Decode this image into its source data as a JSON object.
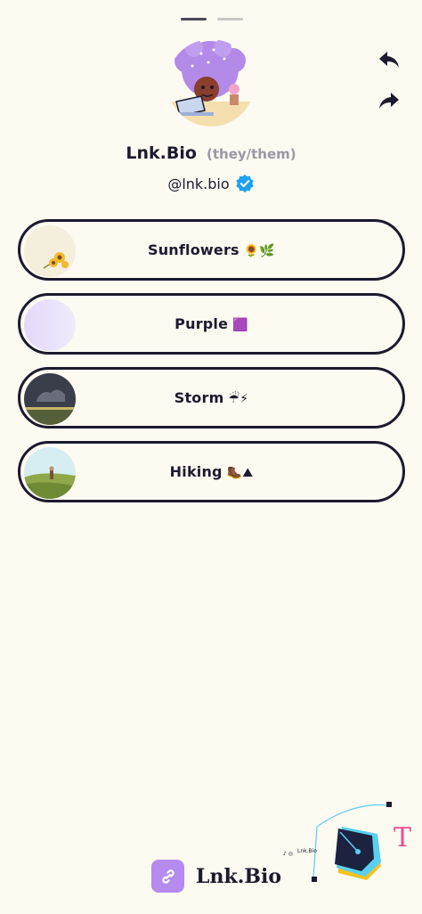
{
  "profile": {
    "name": "Lnk.Bio",
    "pronouns": "(they/them)",
    "handle": "@lnk.bio"
  },
  "links": [
    {
      "label": "Sunflowers",
      "emoji": "🌻🌿"
    },
    {
      "label": "Purple",
      "emoji": "🟪"
    },
    {
      "label": "Storm",
      "emoji": "☔⚡"
    },
    {
      "label": "Hiking",
      "emoji": "🥾⛰"
    }
  ],
  "footer": {
    "logo_text": "Lnk.Bio",
    "promo_handle": "Lnk.Bio"
  },
  "colors": {
    "background": "#fdfaf2",
    "ink": "#1c1a2e",
    "accent": "#b58bf0",
    "verified": "#1da1f2"
  },
  "icons": {
    "back": "back-arrow-icon",
    "share": "share-arrow-icon",
    "verified": "verified-badge-icon",
    "logo": "link-chain-icon"
  }
}
